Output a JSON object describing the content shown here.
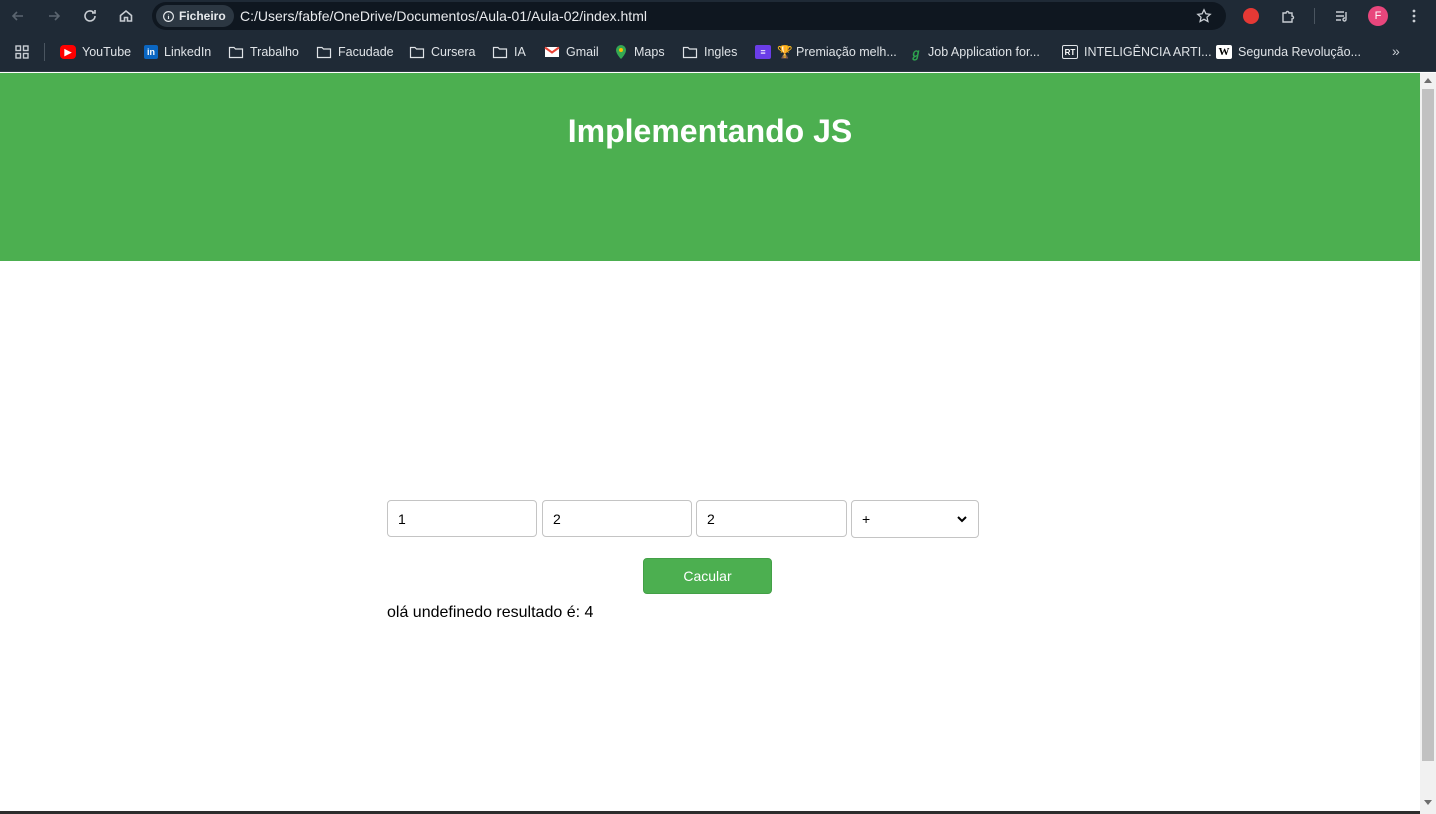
{
  "browser": {
    "site_chip_label": "Ficheiro",
    "url": "C:/Users/fabfe/OneDrive/Documentos/Aula-01/Aula-02/index.html",
    "profile_initial": "F",
    "nav_icons": [
      "back-icon",
      "forward-icon",
      "reload-icon",
      "home-icon"
    ],
    "right_icons": [
      "bookmark-star-icon",
      "extension-red-icon",
      "puzzle-icon",
      "reading-list-icon",
      "profile-avatar",
      "menu-icon"
    ]
  },
  "bookmarks": [
    {
      "label": "YouTube",
      "icon": "youtube-icon",
      "color": "#ff0000"
    },
    {
      "label": "LinkedIn",
      "icon": "linkedin-icon",
      "color": "#0a66c2"
    },
    {
      "label": "Trabalho",
      "icon": "folder-icon"
    },
    {
      "label": "Facudade",
      "icon": "folder-icon"
    },
    {
      "label": "Cursera",
      "icon": "folder-icon"
    },
    {
      "label": "IA",
      "icon": "folder-icon"
    },
    {
      "label": "Gmail",
      "icon": "gmail-icon",
      "color": "#ea4335"
    },
    {
      "label": "Maps",
      "icon": "maps-icon",
      "color": "#34a853"
    },
    {
      "label": "Ingles",
      "icon": "folder-icon"
    },
    {
      "label": "🏆 Premiação melh...",
      "icon": "list-icon",
      "color": "#6a3de8"
    },
    {
      "label": "Job Application for...",
      "icon": "leaf-icon",
      "color": "#2ea44f"
    },
    {
      "label": "INTELIGÊNCIA ARTI...",
      "icon": "rt-icon",
      "color": "#1f8f7a"
    },
    {
      "label": "Segunda Revolução...",
      "icon": "wikipedia-icon",
      "color": "#ffffff"
    }
  ],
  "page": {
    "title": "Implementando JS",
    "inputs": [
      {
        "value": "1"
      },
      {
        "value": "2"
      },
      {
        "value": "2"
      }
    ],
    "operator_selected": "+",
    "button_label": "Cacular",
    "result_text": "olá undefinedo resultado é: 4"
  },
  "colors": {
    "header": "#4caf50",
    "button": "#4caf50",
    "chrome": "#1f2a36"
  }
}
